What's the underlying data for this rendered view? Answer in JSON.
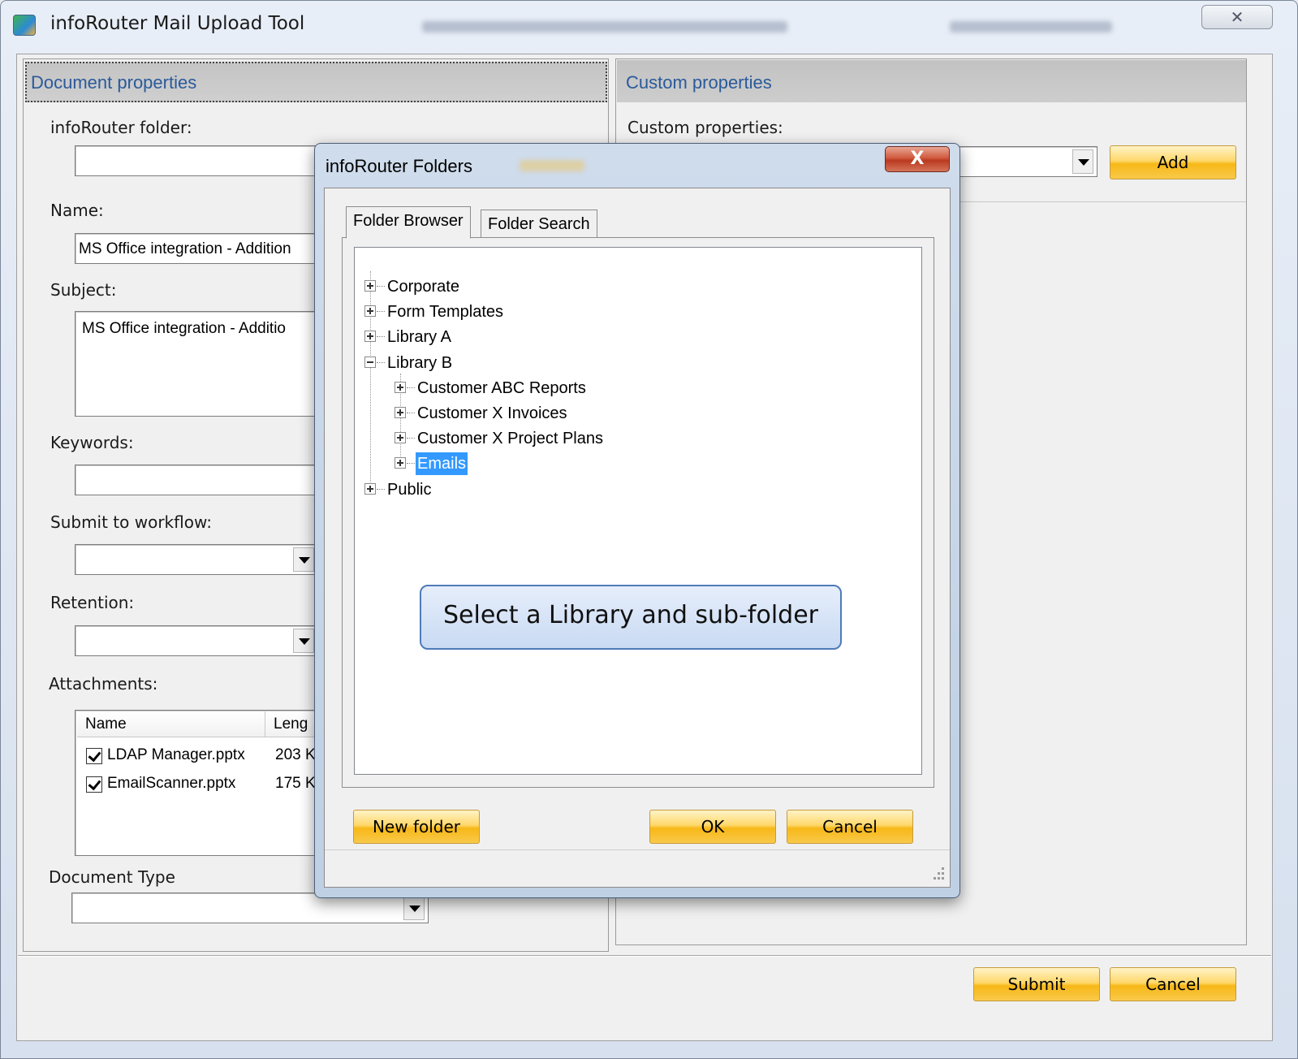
{
  "window": {
    "title": "infoRouter Mail Upload Tool"
  },
  "document_properties": {
    "header": "Document properties",
    "folder_label": "infoRouter folder:",
    "folder_value": "",
    "name_label": "Name:",
    "name_value": "MS Office integration - Addition",
    "subject_label": "Subject:",
    "subject_value": "MS Office integration - Additio",
    "keywords_label": "Keywords:",
    "keywords_value": "",
    "workflow_label": "Submit to workflow:",
    "workflow_value": "",
    "retention_label": "Retention:",
    "retention_value": "",
    "attachments_label": "Attachments:",
    "attachments_columns": [
      "Name",
      "Leng"
    ],
    "attachments": [
      {
        "name": "LDAP Manager.pptx",
        "length": "203 K",
        "checked": true
      },
      {
        "name": "EmailScanner.pptx",
        "length": "175 K",
        "checked": true
      }
    ],
    "doctype_label": "Document Type",
    "doctype_value": ""
  },
  "custom_properties": {
    "header": "Custom properties",
    "label": "Custom properties:",
    "value": "",
    "add_label": "Add"
  },
  "footer": {
    "submit_label": "Submit",
    "cancel_label": "Cancel"
  },
  "dialog": {
    "title": "infoRouter Folders",
    "close_glyph": "X",
    "tabs": [
      "Folder Browser",
      "Folder Search"
    ],
    "active_tab": "Folder Browser",
    "tree": [
      {
        "label": "Corporate",
        "expanded": false,
        "level": 0
      },
      {
        "label": "Form Templates",
        "expanded": false,
        "level": 0
      },
      {
        "label": "Library A",
        "expanded": false,
        "level": 0
      },
      {
        "label": "Library B",
        "expanded": true,
        "level": 0
      },
      {
        "label": "Customer ABC Reports",
        "expanded": false,
        "level": 1
      },
      {
        "label": "Customer X Invoices",
        "expanded": false,
        "level": 1
      },
      {
        "label": "Customer X Project Plans",
        "expanded": false,
        "level": 1
      },
      {
        "label": "Emails",
        "expanded": false,
        "level": 1,
        "selected": true
      },
      {
        "label": "Public",
        "expanded": false,
        "level": 0
      }
    ],
    "callout": "Select a Library and sub-folder",
    "new_folder_label": "New folder",
    "ok_label": "OK",
    "cancel_label": "Cancel"
  },
  "colors": {
    "header_text": "#2a5a9a",
    "selection": "#3399ff",
    "button_gold": "#f7b818"
  },
  "icons": [
    "app-icon",
    "close-icon",
    "dropdown-arrow-icon",
    "checkbox-icon",
    "expand-icon",
    "collapse-icon",
    "resize-grip-icon"
  ]
}
